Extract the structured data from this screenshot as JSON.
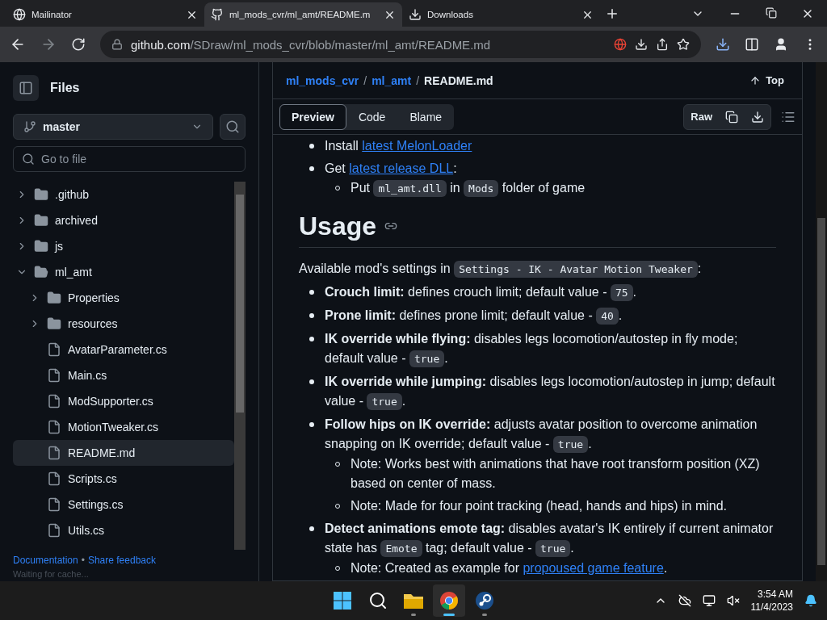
{
  "browser": {
    "tabs": [
      {
        "title": "Mailinator",
        "selected": false
      },
      {
        "title": "ml_mods_cvr/ml_amt/README.m",
        "selected": true
      },
      {
        "title": "Downloads",
        "selected": false
      }
    ],
    "address": {
      "host": "github.com",
      "path": "/SDraw/ml_mods_cvr/blob/master/ml_amt/README.md"
    }
  },
  "sidebar": {
    "title": "Files",
    "branch": "master",
    "search": {
      "placeholder": "Go to file"
    },
    "tree": [
      {
        "name": ".github",
        "kind": "folder",
        "expanded": false,
        "selected": false
      },
      {
        "name": "archived",
        "kind": "folder",
        "expanded": false,
        "selected": false
      },
      {
        "name": "js",
        "kind": "folder",
        "expanded": false,
        "selected": false
      },
      {
        "name": "ml_amt",
        "kind": "folder",
        "expanded": true,
        "selected": false,
        "children": [
          {
            "name": "Properties",
            "kind": "folder",
            "expanded": false,
            "selected": false
          },
          {
            "name": "resources",
            "kind": "folder",
            "expanded": false,
            "selected": false
          },
          {
            "name": "AvatarParameter.cs",
            "kind": "file",
            "selected": false
          },
          {
            "name": "Main.cs",
            "kind": "file",
            "selected": false
          },
          {
            "name": "ModSupporter.cs",
            "kind": "file",
            "selected": false
          },
          {
            "name": "MotionTweaker.cs",
            "kind": "file",
            "selected": false
          },
          {
            "name": "README.md",
            "kind": "file",
            "selected": true
          },
          {
            "name": "Scripts.cs",
            "kind": "file",
            "selected": false
          },
          {
            "name": "Settings.cs",
            "kind": "file",
            "selected": false
          },
          {
            "name": "Utils.cs",
            "kind": "file",
            "selected": false
          }
        ]
      }
    ],
    "footer": [
      {
        "kind": "link",
        "text": "Documentation"
      },
      {
        "kind": "separator",
        "text": "•"
      },
      {
        "kind": "link",
        "text": "Share feedback"
      }
    ],
    "status": "Waiting for cache..."
  },
  "readme": {
    "breadcrumb": [
      {
        "text": "ml_mods_cvr",
        "kind": "link"
      },
      {
        "text": "/",
        "kind": "separator"
      },
      {
        "text": "ml_amt",
        "kind": "link"
      },
      {
        "text": "/",
        "kind": "separator"
      },
      {
        "text": "README.md",
        "kind": "current"
      }
    ],
    "top_label": "Top",
    "view_tabs": [
      {
        "label": "Preview",
        "selected": true
      },
      {
        "label": "Code",
        "selected": false
      },
      {
        "label": "Blame",
        "selected": false
      }
    ],
    "raw_label": "Raw",
    "intro_list": [
      {
        "segments": [
          {
            "kind": "text",
            "text": "Install "
          },
          {
            "kind": "link",
            "text": "latest MelonLoader"
          }
        ]
      },
      {
        "segments": [
          {
            "kind": "text",
            "text": "Get "
          },
          {
            "kind": "link",
            "text": "latest release DLL"
          },
          {
            "kind": "text",
            "text": ":"
          }
        ],
        "children": [
          {
            "segments": [
              {
                "kind": "text",
                "text": "Put "
              },
              {
                "kind": "code",
                "text": "ml_amt.dll"
              },
              {
                "kind": "text",
                "text": " in "
              },
              {
                "kind": "code",
                "text": "Mods"
              },
              {
                "kind": "text",
                "text": " folder of game"
              }
            ]
          }
        ]
      }
    ],
    "heading": "Usage",
    "paragraph": [
      {
        "kind": "text",
        "text": "Available mod's settings in "
      },
      {
        "kind": "code",
        "text": "Settings - IK - Avatar Motion Tweaker"
      },
      {
        "kind": "text",
        "text": ":"
      }
    ],
    "settings_list": [
      {
        "segments": [
          {
            "kind": "bold",
            "text": "Crouch limit:"
          },
          {
            "kind": "text",
            "text": " defines crouch limit; default value - "
          },
          {
            "kind": "code",
            "text": "75"
          },
          {
            "kind": "text",
            "text": "."
          }
        ]
      },
      {
        "segments": [
          {
            "kind": "bold",
            "text": "Prone limit:"
          },
          {
            "kind": "text",
            "text": " defines prone limit; default value - "
          },
          {
            "kind": "code",
            "text": "40"
          },
          {
            "kind": "text",
            "text": "."
          }
        ]
      },
      {
        "segments": [
          {
            "kind": "bold",
            "text": "IK override while flying:"
          },
          {
            "kind": "text",
            "text": " disables legs locomotion/autostep in fly mode; default value - "
          },
          {
            "kind": "code",
            "text": "true"
          },
          {
            "kind": "text",
            "text": "."
          }
        ]
      },
      {
        "segments": [
          {
            "kind": "bold",
            "text": "IK override while jumping:"
          },
          {
            "kind": "text",
            "text": " disables legs locomotion/autostep in jump; default value - "
          },
          {
            "kind": "code",
            "text": "true"
          },
          {
            "kind": "text",
            "text": "."
          }
        ]
      },
      {
        "segments": [
          {
            "kind": "bold",
            "text": "Follow hips on IK override:"
          },
          {
            "kind": "text",
            "text": " adjusts avatar position to overcome animation snapping on IK override; default value - "
          },
          {
            "kind": "code",
            "text": "true"
          },
          {
            "kind": "text",
            "text": "."
          }
        ],
        "children": [
          {
            "segments": [
              {
                "kind": "text",
                "text": "Note: Works best with animations that have root transform position (XZ) based on center of mass."
              }
            ]
          },
          {
            "segments": [
              {
                "kind": "text",
                "text": "Note: Made for four point tracking (head, hands and hips) in mind."
              }
            ]
          }
        ]
      },
      {
        "segments": [
          {
            "kind": "bold",
            "text": "Detect animations emote tag:"
          },
          {
            "kind": "text",
            "text": " disables avatar's IK entirely if current animator state has "
          },
          {
            "kind": "code",
            "text": "Emote"
          },
          {
            "kind": "text",
            "text": " tag; default value - "
          },
          {
            "kind": "code",
            "text": "true"
          },
          {
            "kind": "text",
            "text": "."
          }
        ],
        "children": [
          {
            "segments": [
              {
                "kind": "text",
                "text": "Note: Created as example for "
              },
              {
                "kind": "link",
                "text": "propoused game feature"
              },
              {
                "kind": "text",
                "text": "."
              }
            ]
          }
        ]
      }
    ]
  },
  "taskbar": {
    "apps": [
      {
        "active": false
      },
      {
        "active": false
      },
      {
        "active": false
      },
      {
        "active": true
      },
      {
        "active": false
      }
    ],
    "time": "3:54 AM",
    "date": "11/4/2023"
  }
}
